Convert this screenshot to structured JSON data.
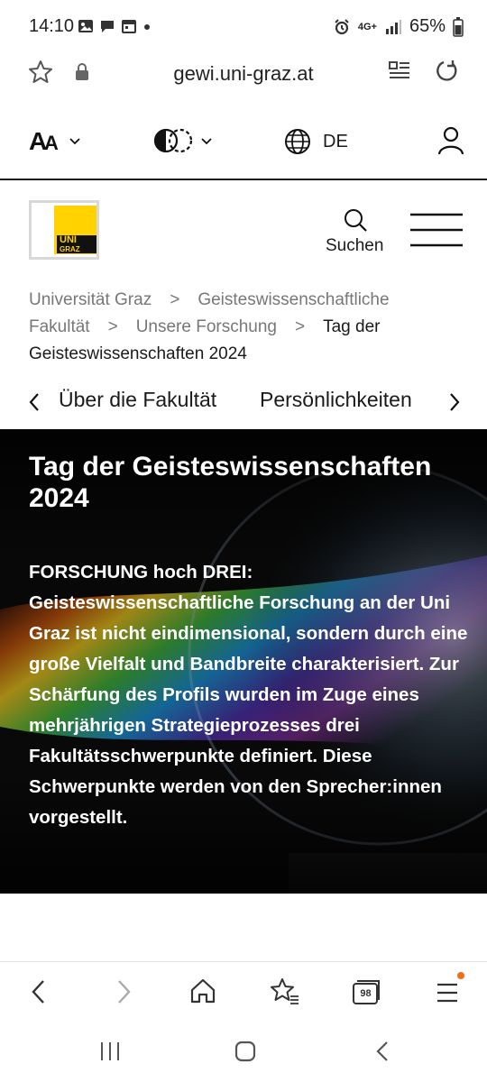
{
  "status_bar": {
    "time": "14:10",
    "battery": "65%",
    "network": "4G+",
    "left_icons": [
      "gallery-icon",
      "chat-icon",
      "calendar-icon",
      "dot-icon"
    ],
    "right_icons": [
      "alarm-icon",
      "network-icon",
      "signal-icon",
      "battery-icon"
    ]
  },
  "browser": {
    "url": "gewi.uni-graz.at",
    "tab_count": "98"
  },
  "utility": {
    "language": "DE"
  },
  "header": {
    "logo_text_line1": "UNI",
    "logo_text_line2": "GRAZ",
    "search_label": "Suchen"
  },
  "breadcrumb": {
    "items": [
      "Universität Graz",
      "Geisteswissenschaftliche Fakultät",
      "Unsere Forschung"
    ],
    "current": "Tag der Geisteswissenschaften 2024"
  },
  "subnav": {
    "items": [
      "Über die Fakultät",
      "Persönlichkeiten"
    ]
  },
  "hero": {
    "title": "Tag der Geisteswissenschaften 2024",
    "text": "FORSCHUNG hoch DREI: Geisteswissenschaftliche Forschung an der Uni Graz ist nicht eindimensional, sondern durch eine große Vielfalt und Bandbreite charakterisiert. Zur Schärfung des Profils wurden im Zuge eines mehrjährigen Strategieprozesses drei Fakultätsschwerpunkte definiert. Diese Schwerpunkte werden von den Sprecher:innen vorgestellt."
  },
  "colors": {
    "brand_yellow": "#ffd200",
    "hero_bg": "#0b0b0b",
    "notification_dot": "#f26c1c"
  }
}
